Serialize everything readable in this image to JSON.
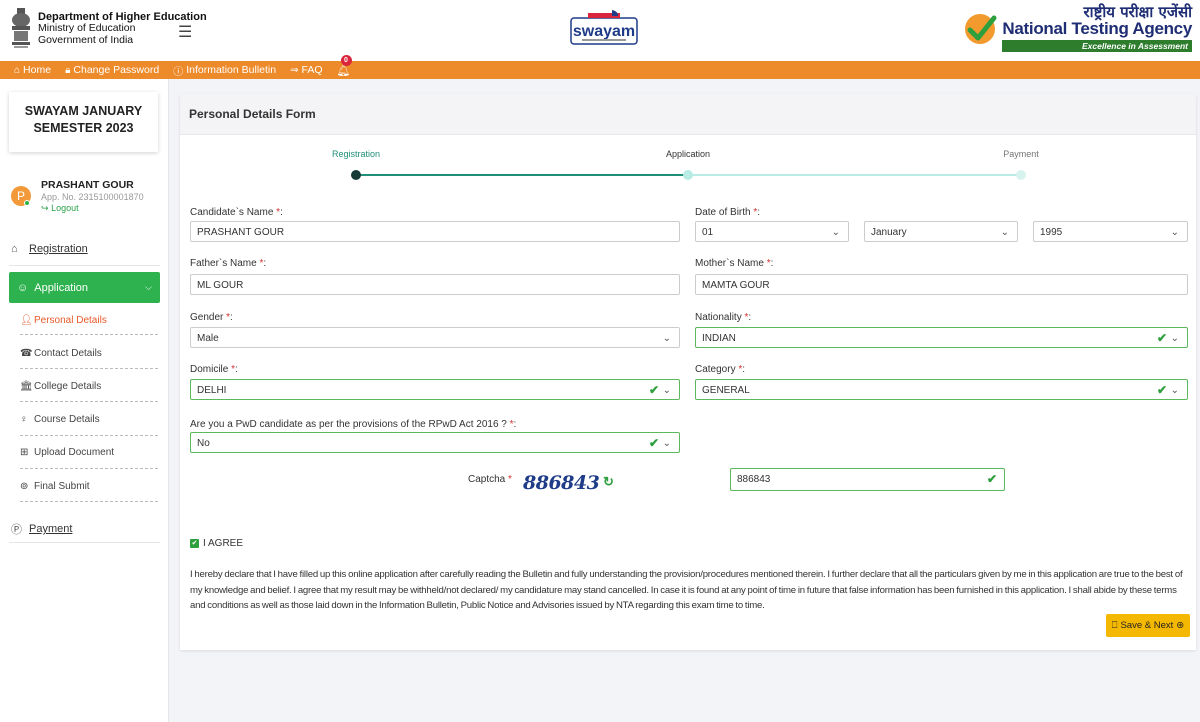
{
  "header": {
    "dept_line1": "Department of Higher Education",
    "dept_line2": "Ministry of Education",
    "dept_line3": "Government of India",
    "menu_icon": "☰",
    "swayam_logo_text": "swayam",
    "nta_hindi": "राष्ट्रीय परीक्षा एजेंसी",
    "nta_english": "National Testing Agency",
    "nta_tagline": "Excellence in Assessment"
  },
  "topnav": {
    "items": [
      {
        "label": "Home",
        "icon": "⌂"
      },
      {
        "label": "Change Password",
        "icon": "🔒︎"
      },
      {
        "label": "Information Bulletin",
        "icon": "ⓘ"
      },
      {
        "label": "FAQ",
        "icon": "⇒"
      }
    ],
    "notifications_count": "0"
  },
  "sidebar": {
    "semester_title": "SWAYAM JANUARY SEMESTER 2023",
    "user": {
      "initial": "P",
      "name": "PRASHANT GOUR",
      "app_no": "App. No. 2315100001870",
      "logout": "Logout"
    },
    "registration": "Registration",
    "application": "Application",
    "sub_items": [
      {
        "label": "Personal Details",
        "icon": "person-icon",
        "active": true
      },
      {
        "label": "Contact Details",
        "icon": "phone-icon"
      },
      {
        "label": "College Details",
        "icon": "building-icon"
      },
      {
        "label": "Course Details",
        "icon": "ribbon-icon"
      },
      {
        "label": "Upload Document",
        "icon": "upload-icon"
      },
      {
        "label": "Final Submit",
        "icon": "check-circle-icon"
      }
    ],
    "payment": "Payment"
  },
  "form": {
    "title": "Personal Details Form",
    "steps": [
      {
        "label": "Registration",
        "state": "done"
      },
      {
        "label": "Application",
        "state": "current"
      },
      {
        "label": "Payment",
        "state": "todo"
      }
    ],
    "candidate_name_label": "Candidate`s Name",
    "candidate_name": "PRASHANT GOUR",
    "dob_label": "Date of Birth",
    "dob_day": "01",
    "dob_month": "January",
    "dob_year": "1995",
    "father_label": "Father`s Name",
    "father_name": "ML GOUR",
    "mother_label": "Mother`s Name",
    "mother_name": "MAMTA GOUR",
    "gender_label": "Gender",
    "gender": "Male",
    "nationality_label": "Nationality",
    "nationality": "INDIAN",
    "domicile_label": "Domicile",
    "domicile": "DELHI",
    "category_label": "Category",
    "category": "GENERAL",
    "pwd_label": "Are you a PwD candidate as per the provisions of the RPwD Act 2016 ?",
    "pwd": "No",
    "required_mark": "*",
    "captcha_label": "Captcha",
    "captcha_text": "886843",
    "captcha_input": "886843",
    "agree_label": "I AGREE",
    "declaration": "I hereby declare that I have filled up this online application after carefully reading the Bulletin and fully understanding the provision/procedures mentioned therein. I further declare that all the particulars given by me in this application are true to the best of my knowledge and belief. I agree that my result may be withheld/not declared/ my candidature may stand cancelled. In case it is found at any point of time in future that false information has been furnished in this application. I shall abide by these terms and conditions as well as those laid down in the Information Bulletin, Public Notice and Advisories issued by NTA regarding this exam time to time.",
    "save_next": "Save & Next"
  },
  "colors": {
    "nav_orange": "#ed8a2a",
    "green": "#2eb24f",
    "step_teal": "#1f8f7a",
    "save_yellow": "#f5b800",
    "active_orange": "#e85a2a"
  }
}
